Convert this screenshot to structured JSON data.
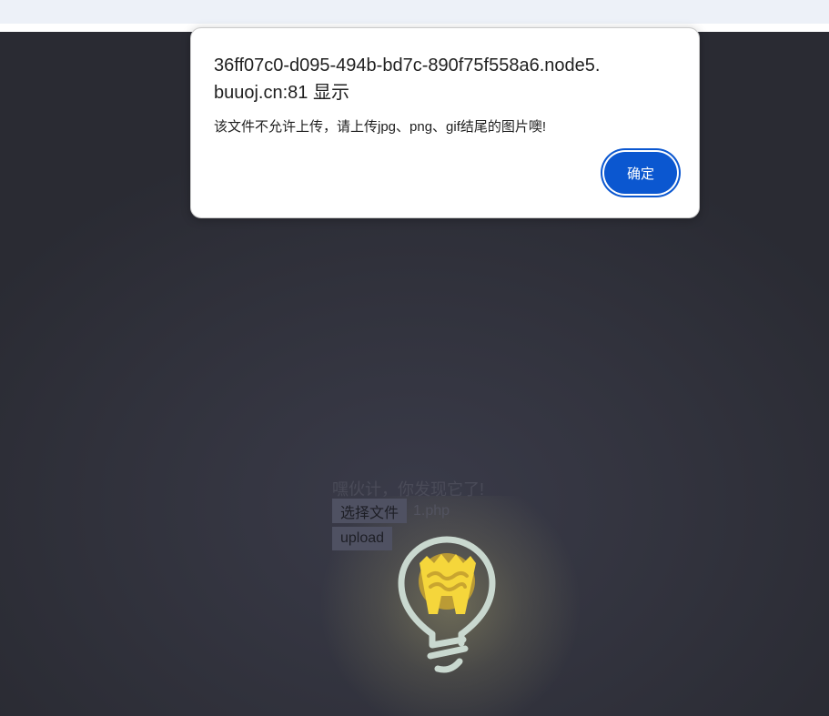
{
  "dialog": {
    "title": "36ff07c0-d095-494b-bd7c-890f75f558a6.node5.buuoj.cn:81 显示",
    "message": "该文件不允许上传，请上传jpg、png、gif结尾的图片噢!",
    "ok_label": "确定"
  },
  "page": {
    "hint": "嘿伙计，你发现它了!",
    "file_button_label": "选择文件",
    "file_name": "1.php",
    "upload_label": "upload"
  },
  "icons": {
    "bulb": "lightbulb-icon"
  },
  "colors": {
    "accent": "#0b57d0",
    "background": "#2b2c34",
    "bulb_yellow": "#f5d63b",
    "bulb_outline": "#c9d8cf"
  }
}
